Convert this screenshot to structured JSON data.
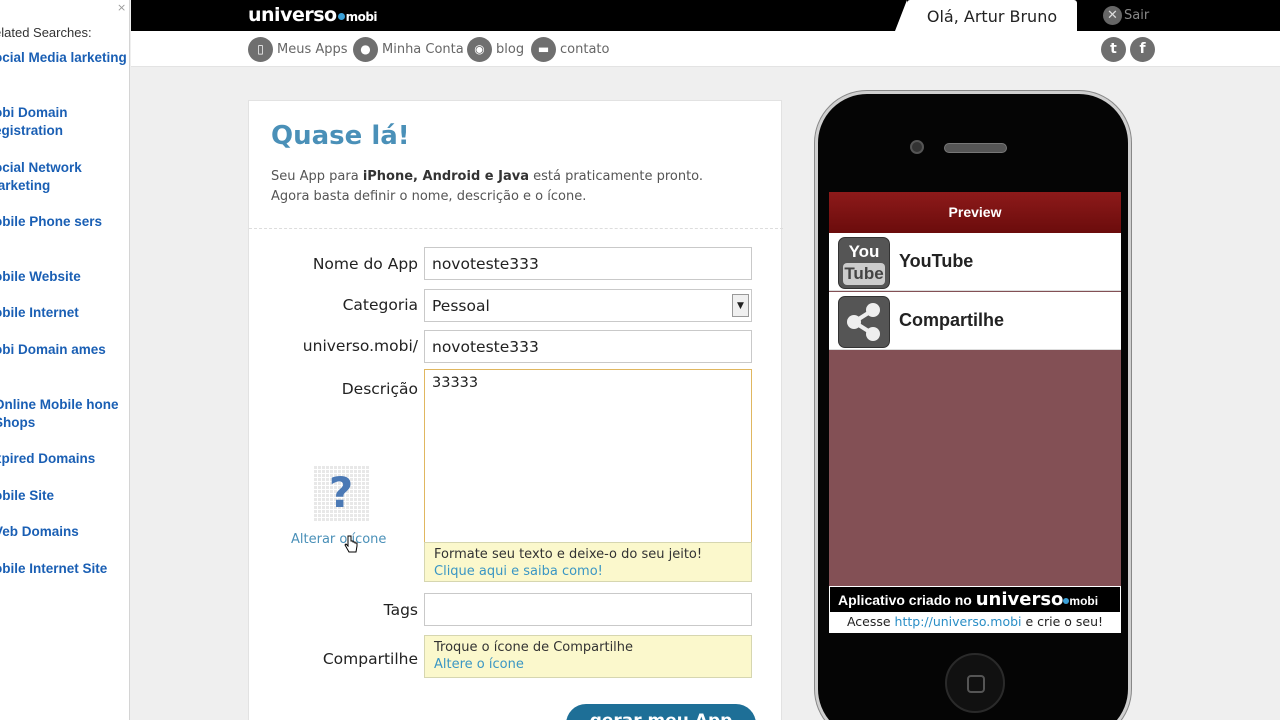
{
  "sidebar": {
    "close": "×",
    "heading": "elated Searches:",
    "items": [
      "ocial Media larketing",
      "obi Domain egistration",
      "ocial Network larketing",
      "obile Phone sers",
      "obile Website",
      "obile Internet",
      "obi Domain ames",
      "Online Mobile hone Shops",
      "xpired Domains",
      "obile Site",
      "Veb Domains",
      "obile Internet Site"
    ]
  },
  "topbar": {
    "logo_main": "univer",
    "logo_end": "so",
    "logo_mobi": "mobi",
    "greeting": "Olá, Artur Bruno",
    "logout": "Sair"
  },
  "nav": {
    "items": [
      "Meus Apps",
      "Minha Conta",
      "blog",
      "contato"
    ],
    "social": [
      "twitter-icon",
      "facebook-icon"
    ]
  },
  "form": {
    "title": "Quase lá!",
    "intro_pre": "Seu App para ",
    "intro_bold": "iPhone, Android e Java",
    "intro_post": " está praticamente pronto.",
    "intro_line2": "Agora basta definir o nome, descrição e o ícone.",
    "name_label": "Nome do App",
    "name_value": "novoteste333",
    "category_label": "Categoria",
    "category_value": "Pessoal",
    "url_label": "universo.mobi/",
    "url_value": "novoteste333",
    "desc_label": "Descrição",
    "desc_value": "33333",
    "format_hint": "Formate seu texto e deixe-o do seu jeito!",
    "format_link": "Clique aqui e saiba como!",
    "change_icon": "Alterar o ícone",
    "tags_label": "Tags",
    "tags_value": "",
    "share_label": "Compartilhe",
    "share_hint": "Troque o ícone de Compartilhe",
    "share_link": "Altere o ícone",
    "submit": "gerar meu App"
  },
  "preview": {
    "header": "Preview",
    "items": [
      {
        "label": "YouTube",
        "icon_top": "You",
        "icon_bottom": "Tube"
      },
      {
        "label": "Compartilhe",
        "icon": "share-icon"
      }
    ],
    "footer_text": "Aplicativo criado no ",
    "footer_brand": "univer",
    "footer_brand_end": "so",
    "footer_mobi": "mobi",
    "footer_link_pre": "Acesse ",
    "footer_link": "http://universo.mobi",
    "footer_link_post": " e crie o seu!"
  },
  "colors": {
    "accent": "#4a90b8",
    "preview_header": "#7a1212",
    "screen_bg": "#835055",
    "hint_bg": "#fbf8cc"
  }
}
